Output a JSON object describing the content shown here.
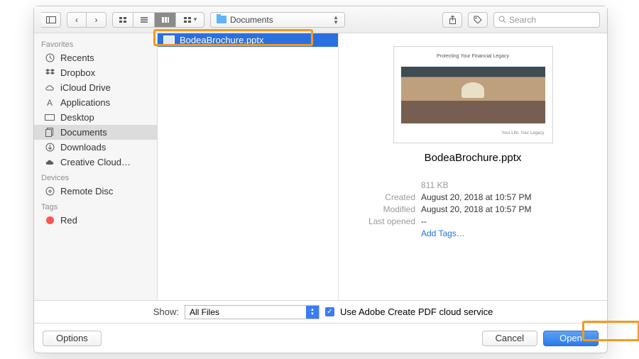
{
  "toolbar": {
    "path_label": "Documents",
    "search_placeholder": "Search"
  },
  "sidebar": {
    "favorites_label": "Favorites",
    "devices_label": "Devices",
    "tags_label": "Tags",
    "recents": "Recents",
    "dropbox": "Dropbox",
    "icloud": "iCloud Drive",
    "applications": "Applications",
    "desktop": "Desktop",
    "documents": "Documents",
    "downloads": "Downloads",
    "creative_cloud": "Creative Cloud…",
    "remote_disc": "Remote Disc",
    "red": "Red"
  },
  "file_list": {
    "selected_name": "BodeaBrochure.pptx"
  },
  "preview": {
    "thumb_title": "Protecting Your Financial Legacy",
    "thumb_sub": "Your Life. Your Legacy.",
    "file_name": "BodeaBrochure.pptx",
    "file_size": "811 KB",
    "created_label": "Created",
    "created_value": "August 20, 2018 at 10:57 PM",
    "modified_label": "Modified",
    "modified_value": "August 20, 2018 at 10:57 PM",
    "lastopened_label": "Last opened",
    "lastopened_value": "--",
    "add_tags": "Add Tags…"
  },
  "show_row": {
    "label": "Show:",
    "value": "All Files",
    "checkbox_label": "Use Adobe Create PDF cloud service"
  },
  "footer": {
    "options": "Options",
    "cancel": "Cancel",
    "open": "Open"
  }
}
